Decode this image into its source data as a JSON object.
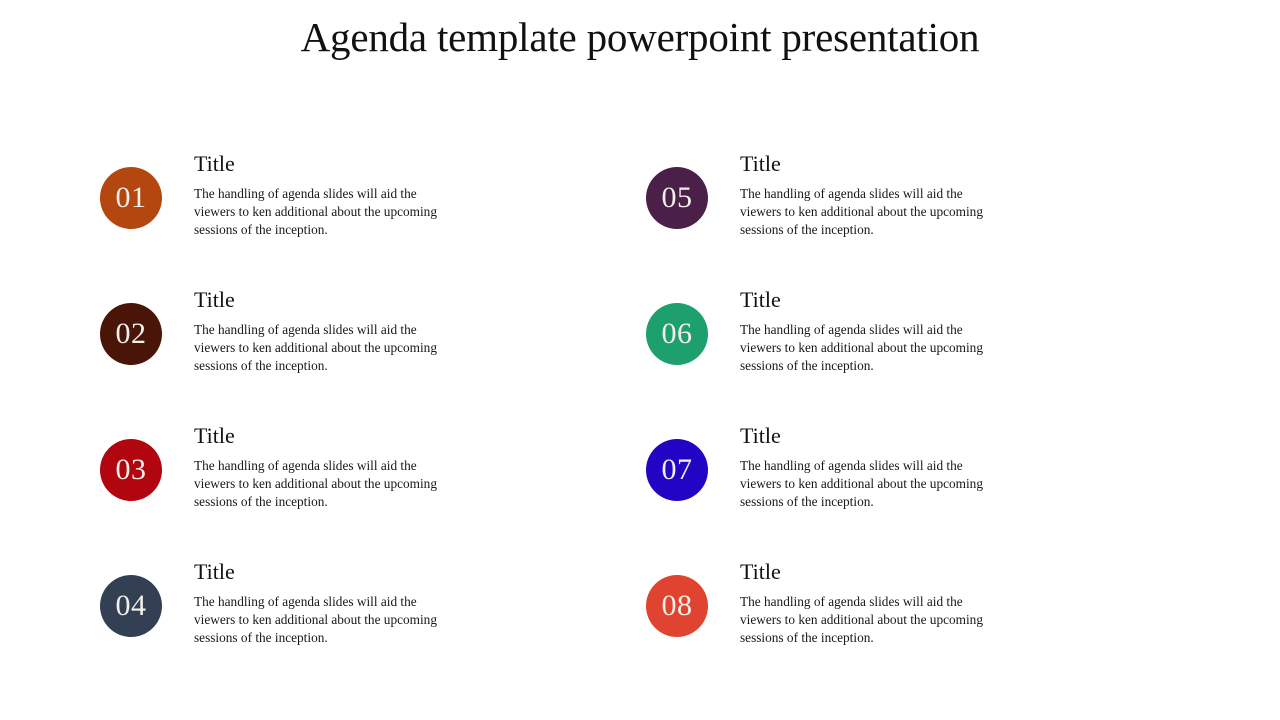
{
  "slide": {
    "title": "Agenda template powerpoint presentation",
    "background_color": "#ffffff",
    "title_color": "#111111",
    "body_text_color": "#17171a"
  },
  "items": [
    {
      "number": "01",
      "title": "Title",
      "description": "The handling of agenda slides will aid the viewers to ken additional about the upcoming sessions of the inception.",
      "color": "#b4470f",
      "column": "left"
    },
    {
      "number": "02",
      "title": "Title",
      "description": "The handling of agenda slides will aid the viewers to ken additional about the upcoming sessions of the inception.",
      "color": "#4a1509",
      "column": "left"
    },
    {
      "number": "03",
      "title": "Title",
      "description": "The handling of agenda slides will aid the viewers to ken additional about the upcoming sessions of the inception.",
      "color": "#b10610",
      "column": "left"
    },
    {
      "number": "04",
      "title": "Title",
      "description": "The handling of agenda slides will aid the viewers to ken additional about the upcoming sessions of the inception.",
      "color": "#334054",
      "column": "left"
    },
    {
      "number": "05",
      "title": "Title",
      "description": "The handling of agenda slides will aid the viewers to ken additional about the upcoming sessions of the inception.",
      "color": "#4a2049",
      "column": "right"
    },
    {
      "number": "06",
      "title": "Title",
      "description": "The handling of agenda slides will aid the viewers to ken additional about the upcoming sessions of the inception.",
      "color": "#1d9f6e",
      "column": "right"
    },
    {
      "number": "07",
      "title": "Title",
      "description": "The handling of agenda slides will aid the viewers to ken additional about the upcoming sessions of the inception.",
      "color": "#2205c4",
      "column": "right"
    },
    {
      "number": "08",
      "title": "Title",
      "description": "The handling of agenda slides will aid the viewers to ken additional about the upcoming sessions of the inception.",
      "color": "#e04430",
      "column": "right"
    }
  ]
}
